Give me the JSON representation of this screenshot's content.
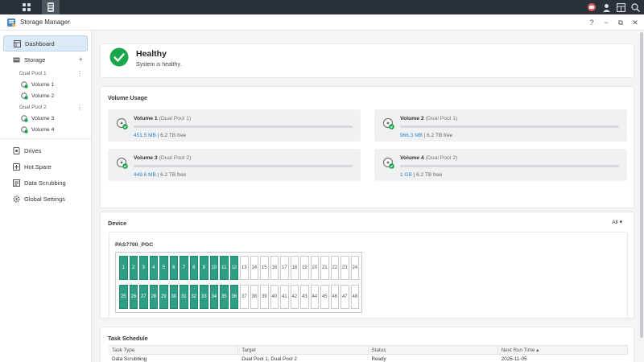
{
  "window": {
    "title": "Storage Manager"
  },
  "sidebar": {
    "items": [
      {
        "label": "Dashboard",
        "icon": "dashboard-icon"
      },
      {
        "label": "Storage",
        "icon": "storage-icon"
      },
      {
        "label": "Drives",
        "icon": "drive-icon"
      },
      {
        "label": "Hot Spare",
        "icon": "hot-spare-icon"
      },
      {
        "label": "Data Scrubbing",
        "icon": "data-scrubbing-icon"
      },
      {
        "label": "Global Settings",
        "icon": "gear-icon"
      }
    ],
    "pools": [
      {
        "name": "Dual Pool 1",
        "volumes": [
          "Volume 1",
          "Volume 2"
        ]
      },
      {
        "name": "Dual Pool 2",
        "volumes": [
          "Volume 3",
          "Volume 4"
        ]
      }
    ]
  },
  "health": {
    "title": "Healthy",
    "subtitle": "System is healthy."
  },
  "volume_usage": {
    "title": "Volume Usage",
    "volumes": [
      {
        "name": "Volume 1",
        "pool": "(Dual Pool 1)",
        "used": "451.5 MB",
        "free": "| 6.2 TB free",
        "fill": 0.0
      },
      {
        "name": "Volume 2",
        "pool": "(Dual Pool 1)",
        "used": "966.3 MB",
        "free": "| 6.2 TB free",
        "fill": 0.0
      },
      {
        "name": "Volume 3",
        "pool": "(Dual Pool 2)",
        "used": "449.6 MB",
        "free": "| 6.2 TB free",
        "fill": 0.0
      },
      {
        "name": "Volume 4",
        "pool": "(Dual Pool 2)",
        "used": "1 GB",
        "free": "| 6.2 TB free",
        "fill": 0.0
      }
    ]
  },
  "device": {
    "title": "Device",
    "filter": "All ▾",
    "name": "PAS7700_POC",
    "bays": [
      {
        "n": "1",
        "used": true
      },
      {
        "n": "2",
        "used": true
      },
      {
        "n": "3",
        "used": true
      },
      {
        "n": "4",
        "used": true
      },
      {
        "n": "5",
        "used": true
      },
      {
        "n": "6",
        "used": true
      },
      {
        "n": "7",
        "used": true
      },
      {
        "n": "8",
        "used": true
      },
      {
        "n": "9",
        "used": true
      },
      {
        "n": "10",
        "used": true
      },
      {
        "n": "11",
        "used": true
      },
      {
        "n": "12",
        "used": true
      },
      {
        "n": "13",
        "used": false
      },
      {
        "n": "14",
        "used": false
      },
      {
        "n": "15",
        "used": false
      },
      {
        "n": "16",
        "used": false
      },
      {
        "n": "17",
        "used": false
      },
      {
        "n": "18",
        "used": false
      },
      {
        "n": "19",
        "used": false
      },
      {
        "n": "20",
        "used": false
      },
      {
        "n": "21",
        "used": false
      },
      {
        "n": "22",
        "used": false
      },
      {
        "n": "23",
        "used": false
      },
      {
        "n": "24",
        "used": false
      },
      {
        "n": "25",
        "used": true
      },
      {
        "n": "26",
        "used": true
      },
      {
        "n": "27",
        "used": true
      },
      {
        "n": "28",
        "used": true
      },
      {
        "n": "29",
        "used": true
      },
      {
        "n": "30",
        "used": true
      },
      {
        "n": "31",
        "used": true
      },
      {
        "n": "32",
        "used": true
      },
      {
        "n": "33",
        "used": true
      },
      {
        "n": "34",
        "used": true
      },
      {
        "n": "35",
        "used": true
      },
      {
        "n": "36",
        "used": true
      },
      {
        "n": "37",
        "used": false
      },
      {
        "n": "38",
        "used": false
      },
      {
        "n": "39",
        "used": false
      },
      {
        "n": "40",
        "used": false
      },
      {
        "n": "41",
        "used": false
      },
      {
        "n": "42",
        "used": false
      },
      {
        "n": "43",
        "used": false
      },
      {
        "n": "44",
        "used": false
      },
      {
        "n": "45",
        "used": false
      },
      {
        "n": "46",
        "used": false
      },
      {
        "n": "47",
        "used": false
      },
      {
        "n": "48",
        "used": false
      }
    ]
  },
  "task_schedule": {
    "title": "Task Schedule",
    "columns": [
      "Task Type",
      "Target",
      "Status",
      "Next Run Time ▴"
    ],
    "rows": [
      [
        "Data Scrubbing",
        "Dual Pool 1, Dual Pool 2",
        "Ready",
        "2025-11-05"
      ]
    ]
  },
  "colors": {
    "accent": "#3c8ed2",
    "healthy": "#1aa64a",
    "bay_used": "#2e9e84"
  }
}
